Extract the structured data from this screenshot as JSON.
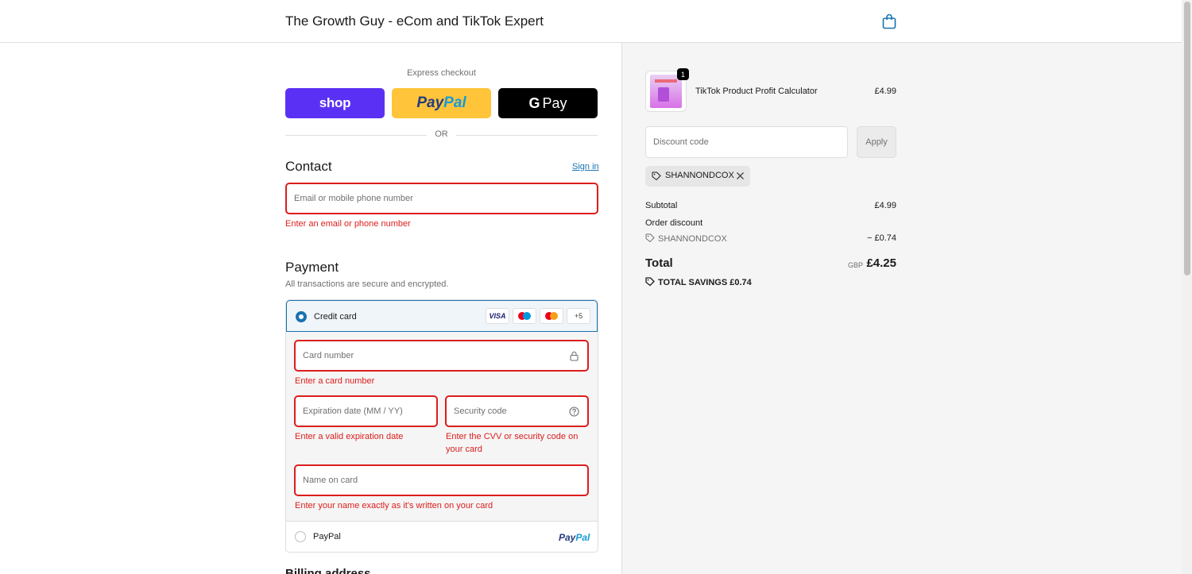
{
  "header": {
    "shop_title": "The Growth Guy - eCom and TikTok Expert",
    "cart_icon": "shopping-bag-icon"
  },
  "express": {
    "label": "Express checkout",
    "shop_label": "shop",
    "paypal_part1": "Pay",
    "paypal_part2": "Pal",
    "gpay_g": "G",
    "gpay_label": "Pay",
    "or_label": "OR"
  },
  "contact": {
    "title": "Contact",
    "sign_in": "Sign in",
    "email_placeholder": "Email or mobile phone number",
    "email_error": "Enter an email or phone number"
  },
  "payment": {
    "title": "Payment",
    "subtitle": "All transactions are secure and encrypted.",
    "credit_card_label": "Credit card",
    "card_brands": [
      "VISA",
      "maestro",
      "mastercard",
      "+5"
    ],
    "card_number_placeholder": "Card number",
    "card_number_error": "Enter a card number",
    "expiry_placeholder": "Expiration date (MM / YY)",
    "expiry_error": "Enter a valid expiration date",
    "cvv_placeholder": "Security code",
    "cvv_error": "Enter the CVV or security code on your card",
    "name_placeholder": "Name on card",
    "name_error": "Enter your name exactly as it's written on your card",
    "paypal_label": "PayPal",
    "paypal_logo_1": "Pay",
    "paypal_logo_2": "Pal"
  },
  "billing": {
    "title": "Billing address"
  },
  "summary": {
    "quantity": "1",
    "product_name": "TikTok Product Profit Calculator",
    "product_price": "£4.99",
    "discount_placeholder": "Discount code",
    "apply_label": "Apply",
    "applied_code": "SHANNONDCOX",
    "subtotal_label": "Subtotal",
    "subtotal_value": "£4.99",
    "order_discount_label": "Order discount",
    "order_discount_code": "SHANNONDCOX",
    "order_discount_value": "− £0.74",
    "total_label": "Total",
    "currency": "GBP",
    "total_value": "£4.25",
    "savings_label": "TOTAL SAVINGS",
    "savings_value": "£0.74"
  },
  "colors": {
    "accent": "#1773b0",
    "error": "#dd1d1d",
    "shop_purple": "#5a31f4",
    "paypal_yellow": "#ffc439"
  }
}
